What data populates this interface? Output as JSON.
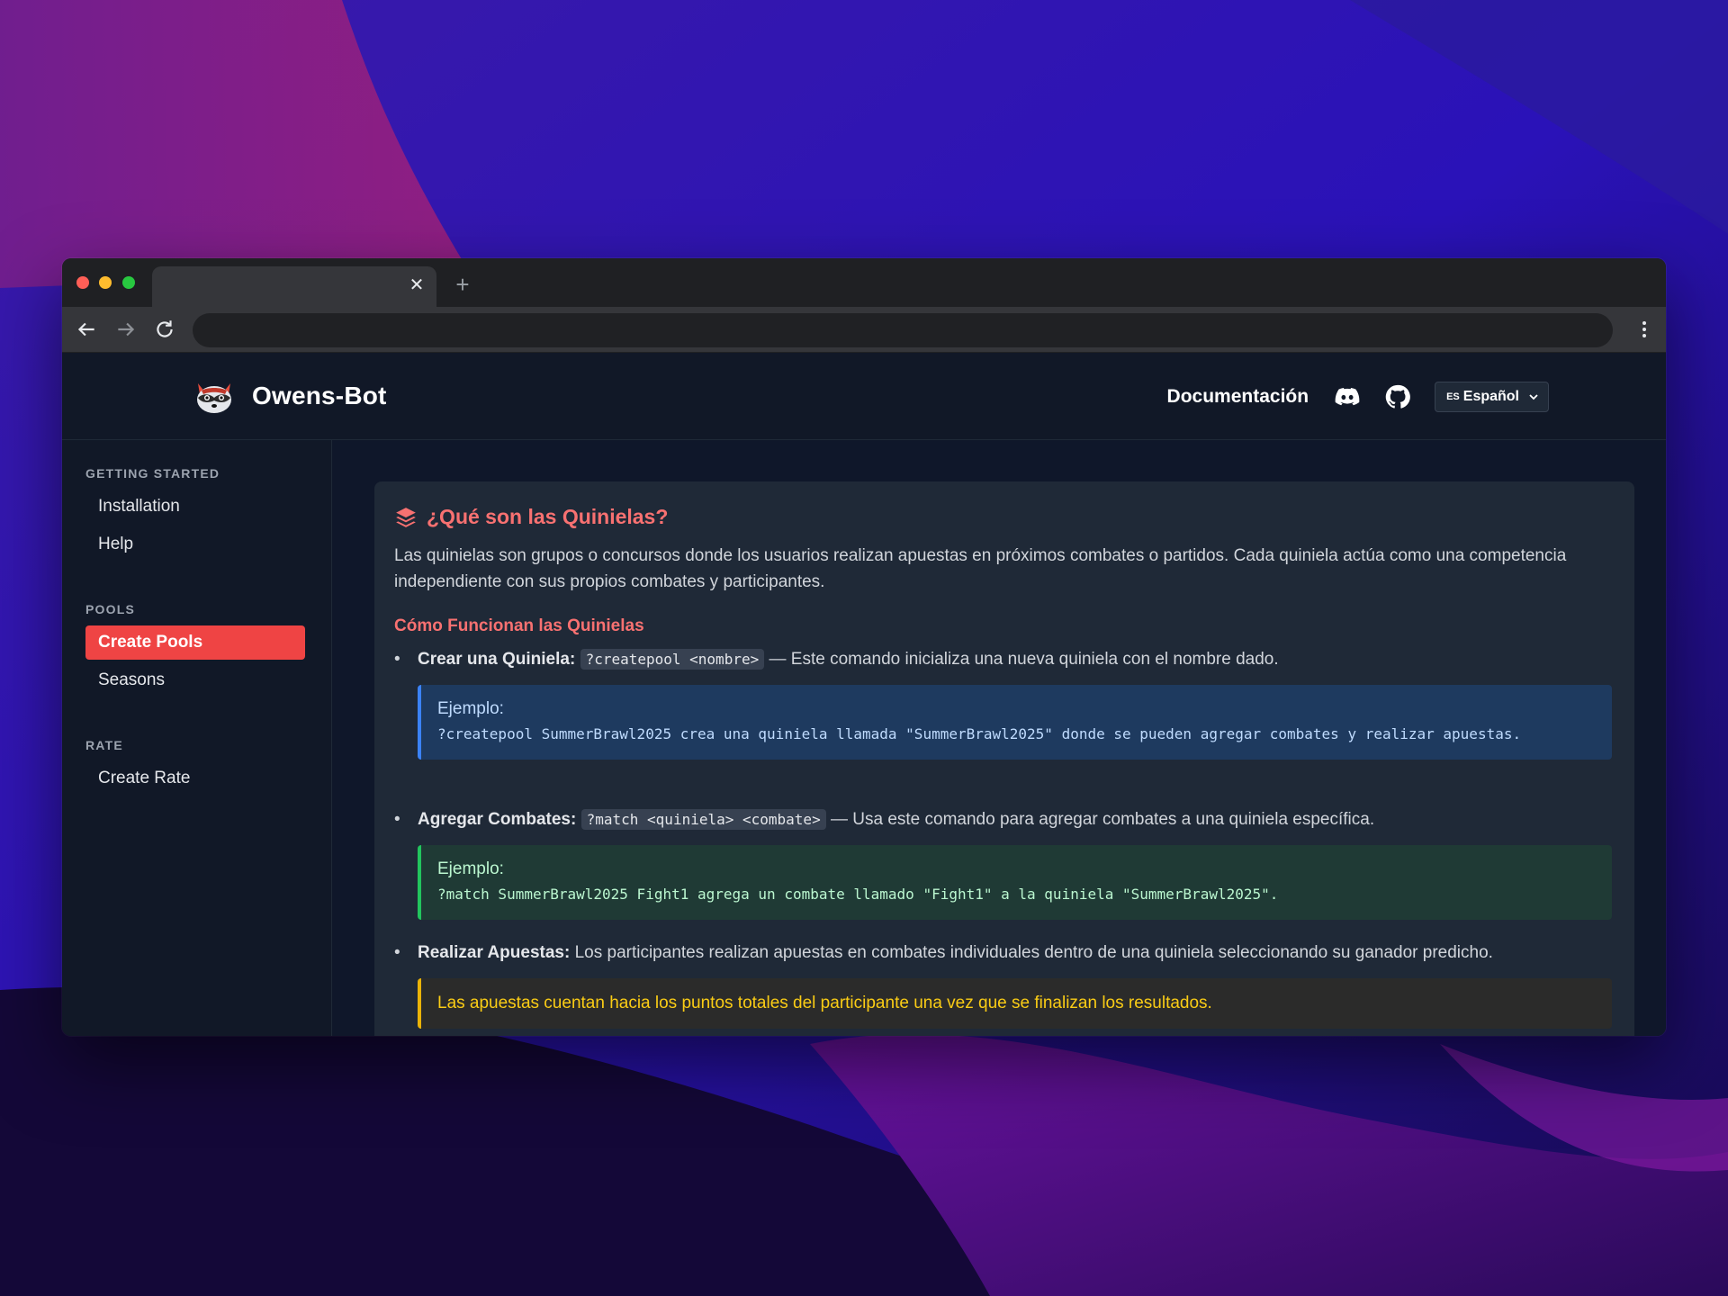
{
  "browser": {
    "tab_close": "✕",
    "new_tab": "+"
  },
  "header": {
    "brand": "Owens-Bot",
    "docs_link": "Documentación",
    "language": {
      "flag": "ES",
      "selected": "Español"
    }
  },
  "sidebar": {
    "sections": [
      {
        "title": "GETTING STARTED",
        "items": [
          "Installation",
          "Help"
        ]
      },
      {
        "title": "POOLS",
        "items": [
          "Create Pools",
          "Seasons"
        ]
      },
      {
        "title": "RATE",
        "items": [
          "Create Rate"
        ]
      }
    ],
    "active_item": "Create Pools"
  },
  "content": {
    "title": "¿Qué son las Quinielas?",
    "intro": "Las quinielas son grupos o concursos donde los usuarios realizan apuestas en próximos combates o partidos. Cada quiniela actúa como una competencia independiente con sus propios combates y participantes.",
    "subheading": "Cómo Funcionan las Quinielas",
    "bullets": [
      {
        "label": "Crear una Quiniela:",
        "code": "?createpool <nombre>",
        "text": " — Este comando inicializa una nueva quiniela con el nombre dado.",
        "example_label": "Ejemplo:",
        "example_code": "?createpool SummerBrawl2025 crea una quiniela llamada \"SummerBrawl2025\" donde se pueden agregar combates y realizar apuestas."
      },
      {
        "label": "Agregar Combates:",
        "code": "?match <quiniela> <combate>",
        "text": " — Usa este comando para agregar combates a una quiniela específica.",
        "example_label": "Ejemplo:",
        "example_code": "?match SummerBrawl2025 Fight1 agrega un combate llamado \"Fight1\" a la quiniela \"SummerBrawl2025\"."
      },
      {
        "label": "Realizar Apuestas:",
        "text": " Los participantes realizan apuestas en combates individuales dentro de una quiniela seleccionando su ganador predicho.",
        "note": "Las apuestas cuentan hacia los puntos totales del participante una vez que se finalizan los resultados."
      }
    ]
  },
  "colors": {
    "accent": "#ef4444",
    "title_red": "#f87171",
    "page_bg": "#0f172a",
    "card_bg": "#1f2937",
    "info_blue": "#3b82f6",
    "success_green": "#22c55e",
    "warning_yellow": "#eab308"
  },
  "icons": {
    "logo": "raccoon-logo-icon",
    "discord": "discord-icon",
    "github": "github-icon",
    "title": "layers-icon",
    "back": "arrow-left-icon",
    "forward": "arrow-right-icon",
    "reload": "reload-icon",
    "menu": "kebab-menu-icon"
  }
}
